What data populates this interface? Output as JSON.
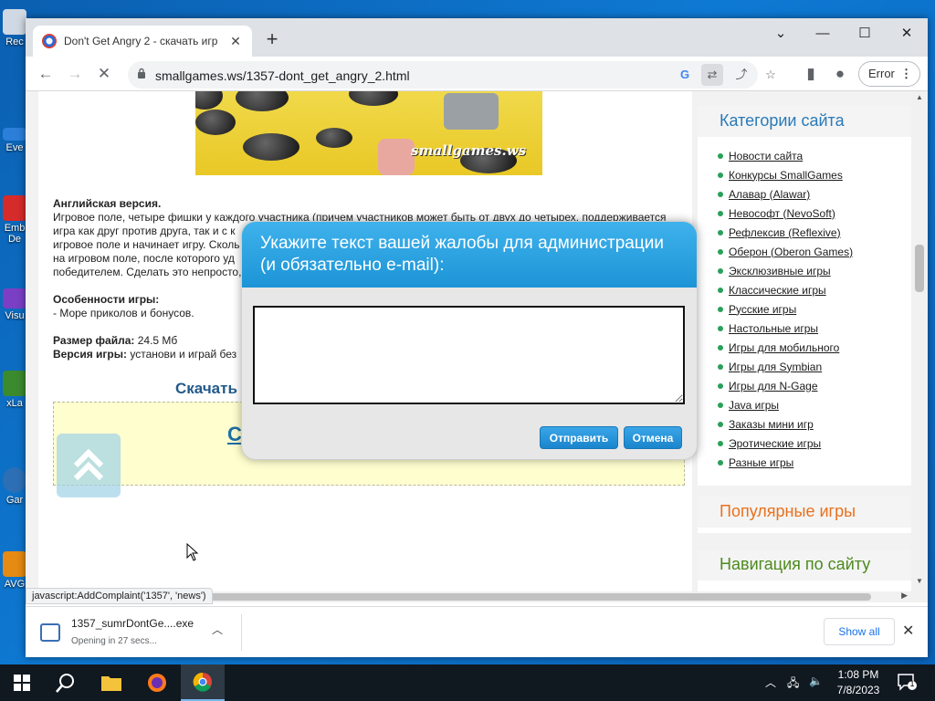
{
  "desktop": {
    "icons": [
      {
        "label": "Rec",
        "color": "#cfd8e3"
      },
      {
        "label": "Eve",
        "color": "#2b7fd9"
      },
      {
        "label": "Emb",
        "sub": "De",
        "color": "#d62b2b"
      },
      {
        "label": "Visu",
        "color": "#7a3fc4"
      },
      {
        "label": "xLa",
        "color": "#3c8a2e"
      },
      {
        "label": "Gar",
        "color": "#2d6fb5"
      },
      {
        "label": "AVG",
        "color": "#e58a12"
      }
    ]
  },
  "browser": {
    "tab_title": "Don't Get Angry 2 - скачать игр",
    "url": "smallgames.ws/1357-dont_get_angry_2.html",
    "error_label": "Error"
  },
  "page": {
    "image_watermark": "smallgames.ws",
    "version_heading": "Английская версия.",
    "desc_lines": [
      "Игровое поле, четыре фишки у каждого участника (причем участников может быть от двух до четырех, поддерживается",
      "игра как друг против друга, так и с к",
      "игровое поле и начинает игру. Сколь",
      "на игровом поле, после которого уд",
      "победителем. Сделать это непросто,"
    ],
    "features_heading": "Особенности игры:",
    "features_line": "- Море приколов и бонусов.",
    "filesize_label": "Размер файла:",
    "filesize_value": "24.5 Мб",
    "version_label": "Версия игры:",
    "version_value": "установи и играй без",
    "download_heading": "Скачать",
    "download_link": "С"
  },
  "sidebar": {
    "categories_title": "Категории сайта",
    "categories": [
      "Новости сайта",
      "Конкурсы SmallGames",
      "Алавар (Alawar)",
      "Невософт (NevoSoft)",
      "Рефлексив (Reflexive)",
      "Оберон (Oberon Games)",
      "Эксклюзивные игры",
      "Классические игры",
      "Русские игры",
      "Настольные игры",
      "Игры для мобильного",
      "Игры для Symbian",
      "Игры для N-Gage",
      "Java игры",
      "Заказы мини игр",
      "Эротические игры",
      "Разные игры"
    ],
    "popular_title": "Популярные игры",
    "nav_title": "Навигация по сайту",
    "colors": {
      "categories": "#2a7ab8",
      "popular": "#e8711e",
      "nav": "#4d8a1e"
    }
  },
  "modal": {
    "title": "Укажите текст вашей жалобы для администрации (и обязательно e-mail):",
    "textarea_value": "",
    "submit_label": "Отправить",
    "cancel_label": "Отмена"
  },
  "status_tip": "javascript:AddComplaint('1357', 'news')",
  "download": {
    "file_name": "1357_sumrDontGe....exe",
    "status": "Opening in 27 secs...",
    "show_all": "Show all"
  },
  "taskbar": {
    "time": "1:08 PM",
    "date": "7/8/2023",
    "notification_count": "1"
  }
}
